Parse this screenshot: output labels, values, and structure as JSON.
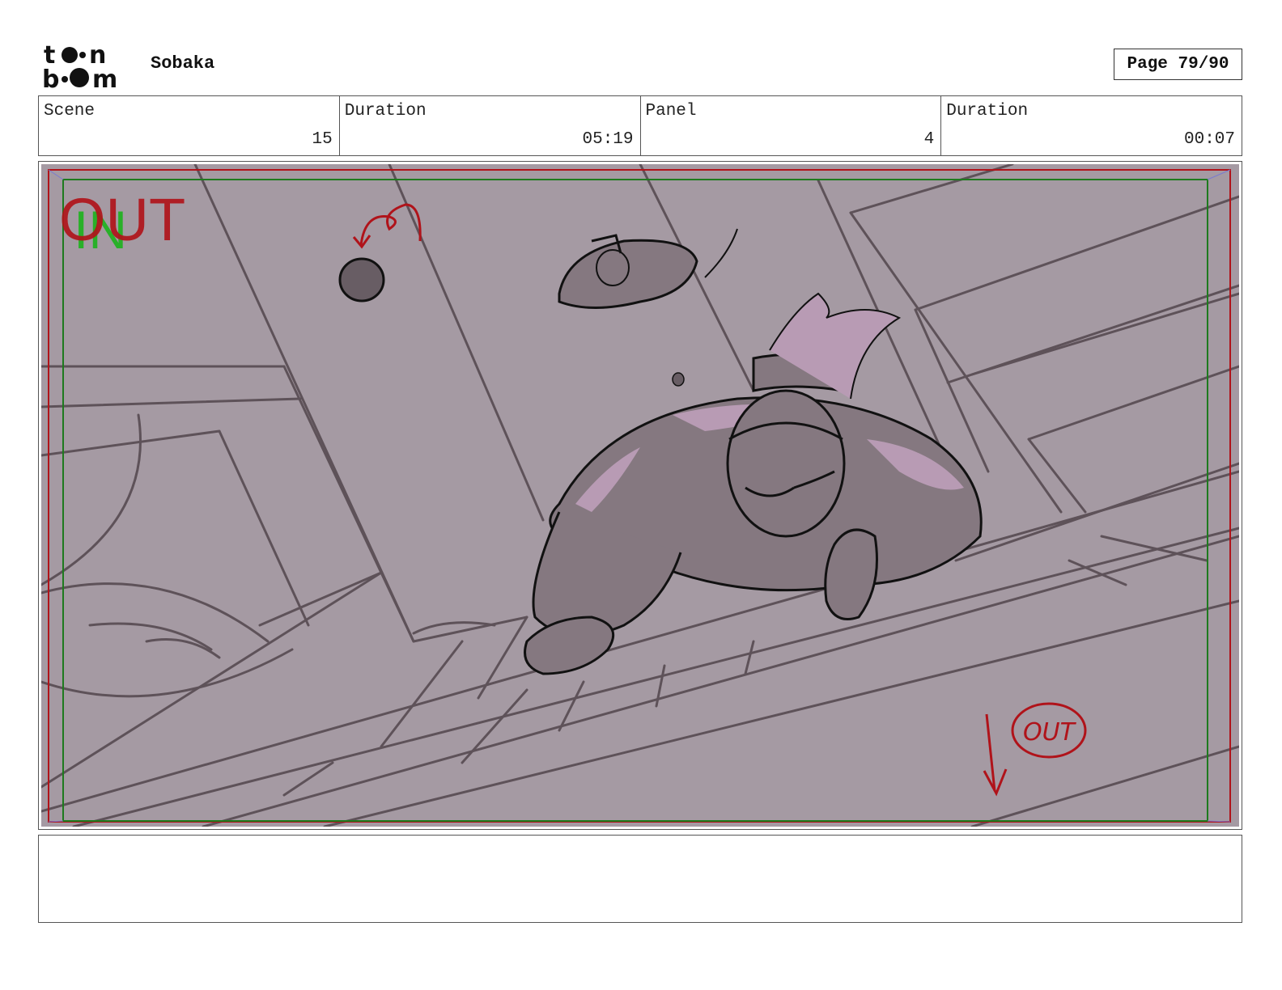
{
  "header": {
    "logo_alt": "toon boom",
    "project": "Sobaka",
    "page": "Page 79/90"
  },
  "info": [
    {
      "label": "Scene",
      "value": "15"
    },
    {
      "label": "Duration",
      "value": "05:19"
    },
    {
      "label": "Panel",
      "value": "4"
    },
    {
      "label": "Duration",
      "value": "00:07"
    }
  ],
  "panel": {
    "marker_out": "OUT",
    "marker_in": "IN",
    "note_out": "OUT",
    "colors": {
      "background": "#a59aa3",
      "line": "#5e5259",
      "character": "#857880",
      "highlight": "#b89bb4",
      "ink": "#111111",
      "red": "#b0131a",
      "green": "#1e7a1e"
    }
  },
  "caption": ""
}
